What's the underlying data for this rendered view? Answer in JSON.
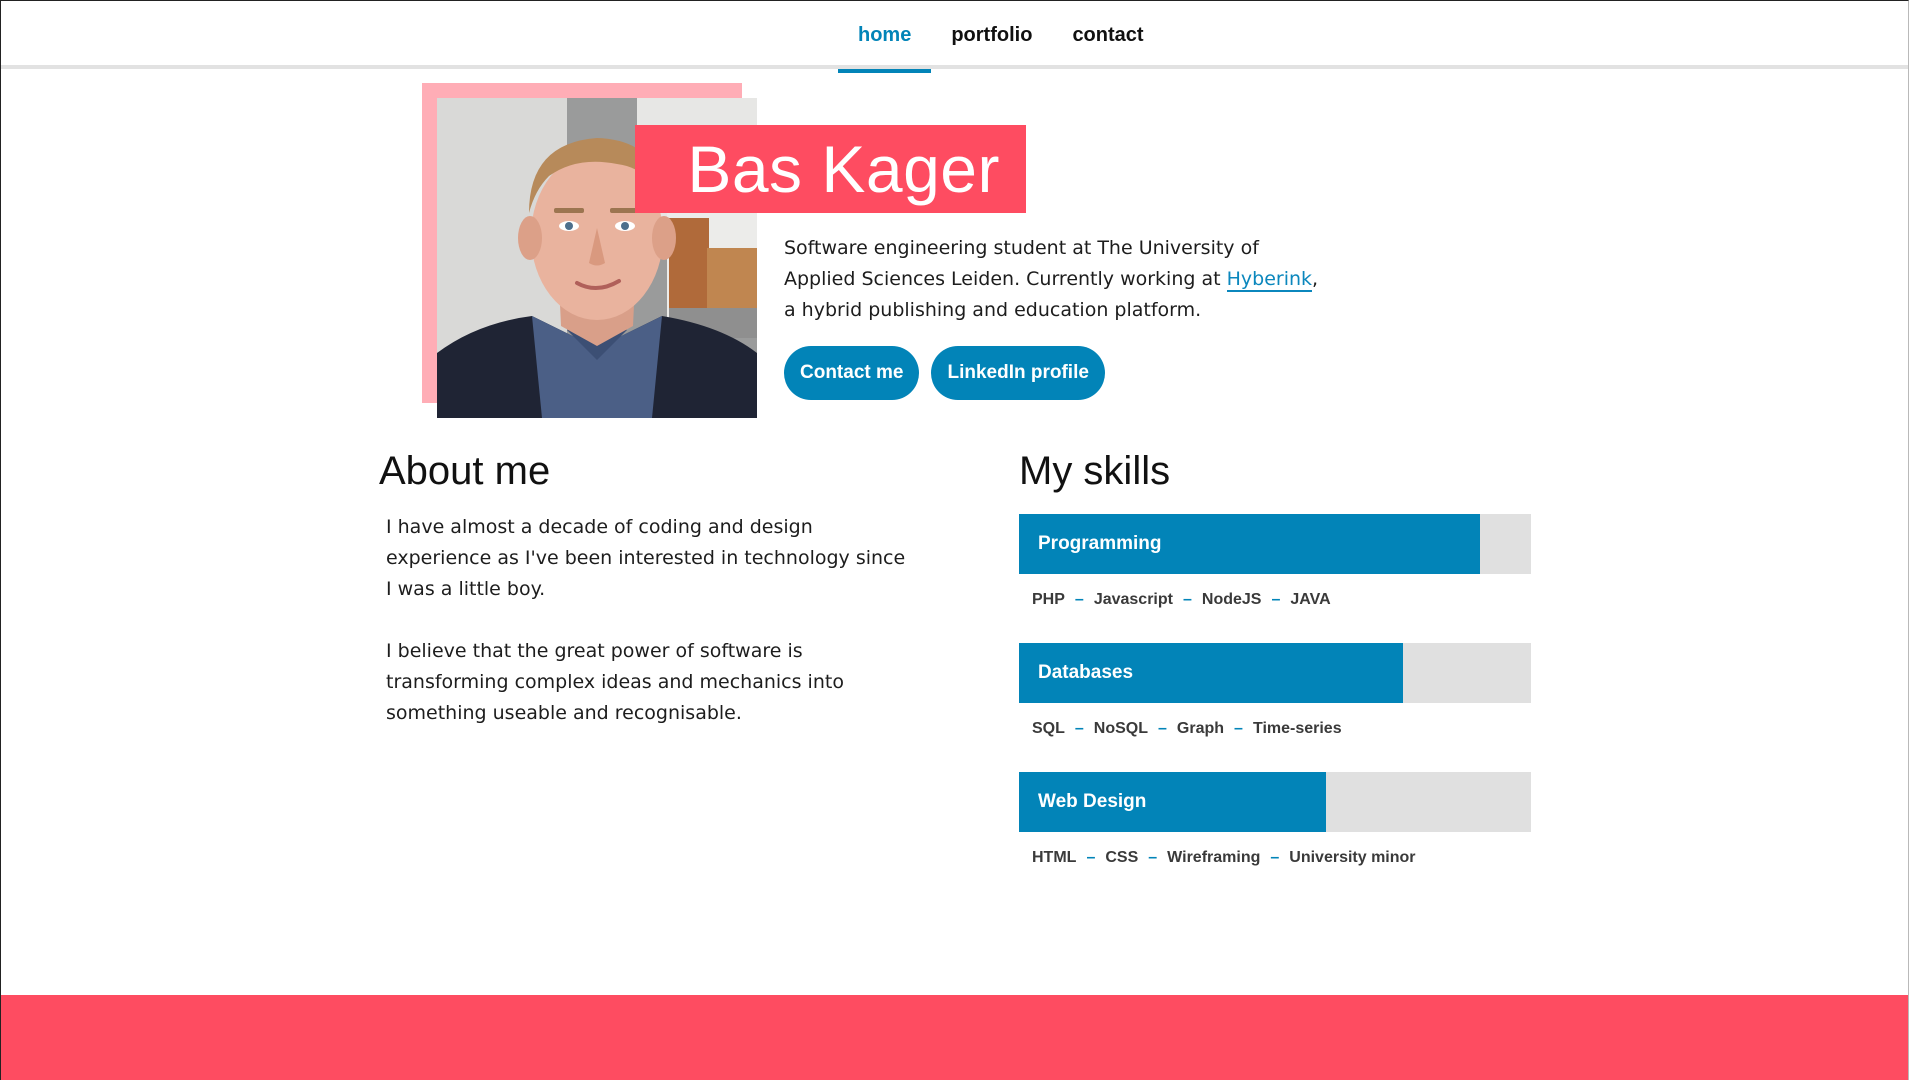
{
  "nav": {
    "items": [
      {
        "label": "home",
        "active": true
      },
      {
        "label": "portfolio",
        "active": false
      },
      {
        "label": "contact",
        "active": false
      }
    ]
  },
  "hero": {
    "name": "Bas Kager",
    "intro_before": "Software engineering student at The University of Applied Sciences Leiden. Currently working at ",
    "intro_link": "Hyberink",
    "intro_after": ", a hybrid publishing and education platform.",
    "buttons": {
      "contact": "Contact me",
      "linkedin": "LinkedIn profile"
    }
  },
  "about": {
    "title": "About me",
    "paragraphs": [
      "I have almost a decade of coding and design experience as I've been interested in technology since I was a little boy.",
      "I believe that the great power of software is transforming complex ideas and mechanics into something useable and recognisable."
    ]
  },
  "skills": {
    "title": "My skills",
    "items": [
      {
        "label": "Programming",
        "level": 0.9,
        "tags": [
          "PHP",
          "Javascript",
          "NodeJS",
          "JAVA"
        ]
      },
      {
        "label": "Databases",
        "level": 0.75,
        "tags": [
          "SQL",
          "NoSQL",
          "Graph",
          "Time-series"
        ]
      },
      {
        "label": "Web Design",
        "level": 0.6,
        "tags": [
          "HTML",
          "CSS",
          "Wireframing",
          "University minor"
        ]
      }
    ]
  },
  "colors": {
    "accent_blue": "#0284b8",
    "accent_pink": "#fe4c61",
    "photo_frame": "#ffadb6",
    "bar_track": "#e0e0e0"
  }
}
